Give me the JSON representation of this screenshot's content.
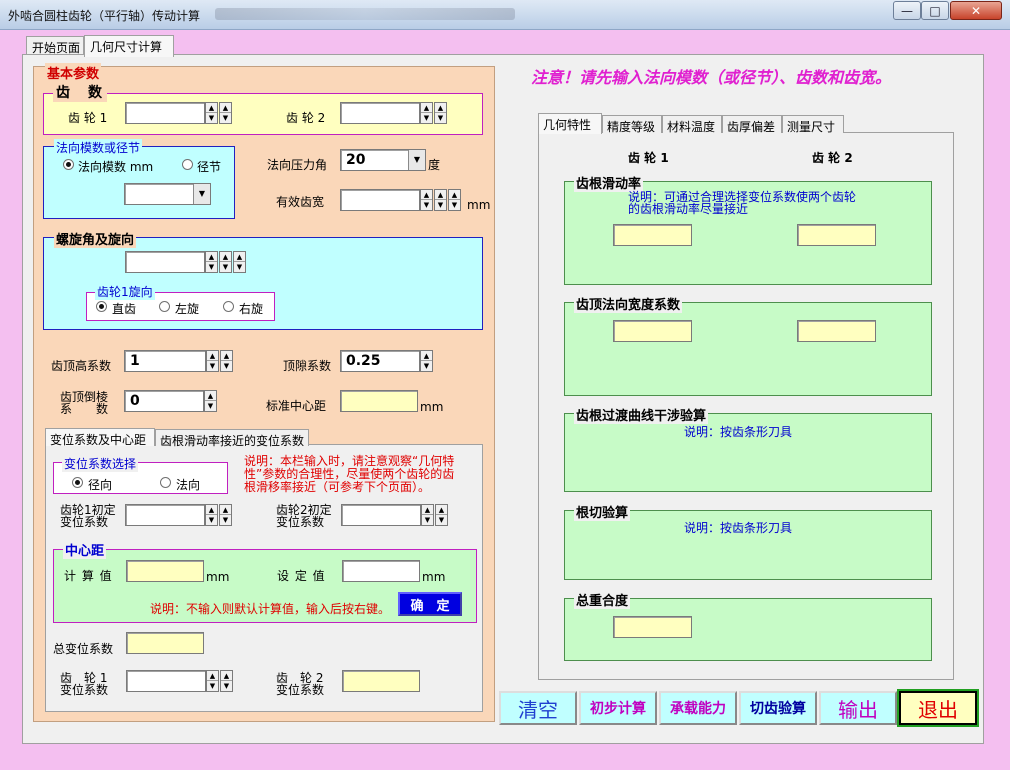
{
  "window": {
    "title": "外啮合圆柱齿轮（平行轴）传动计算",
    "min": "—",
    "max": "□",
    "close": "✕"
  },
  "tabs": [
    "开始页面",
    "几何尺寸计算"
  ],
  "basic": {
    "title": "基本参数",
    "teeth": {
      "title": "齿　数",
      "gear1": "齿 轮 1",
      "gear2": "齿 轮 2"
    },
    "module": {
      "title": "法向模数或径节",
      "opt1": "法向模数 mm",
      "opt2": "径节"
    },
    "pressure": {
      "label": "法向压力角",
      "value": "20",
      "unit": "度"
    },
    "facewidth": {
      "label": "有效齿宽",
      "unit": "mm"
    },
    "helix": {
      "title": "螺旋角及旋向",
      "sub": "齿轮1旋向",
      "opt1": "直齿",
      "opt2": "左旋",
      "opt3": "右旋"
    },
    "addendum": {
      "label": "齿顶高系数",
      "value": "1"
    },
    "clearance": {
      "label": "顶隙系数",
      "value": "0.25"
    },
    "chamfer": {
      "label1": "齿顶倒棱",
      "label2": "系　　数",
      "value": "0"
    },
    "center_std": {
      "label": "标准中心距",
      "unit": "mm"
    }
  },
  "subtabs": [
    "变位系数及中心距",
    "齿根滑动率接近的变位系数"
  ],
  "shift": {
    "title": "变位系数选择",
    "opt1": "径向",
    "opt2": "法向",
    "note": "说明：本栏输入时，请注意观察“几何特性”参数的合理性，尽量使两个齿轮的齿根滑移率接近（可参考下个页面）。",
    "g1a": "齿轮1初定",
    "g1b": "变位系数",
    "g2a": "齿轮2初定",
    "g2b": "变位系数"
  },
  "center": {
    "title": "中心距",
    "calc": "计 算 值",
    "calc_unit": "mm",
    "set": "设 定 值",
    "set_unit": "mm",
    "note": "说明：不输入则默认计算值，输入后按右键。",
    "ok": "确　定"
  },
  "total": {
    "label": "总变位系数"
  },
  "final": {
    "g1a": "齿　轮 1",
    "g1b": "变位系数",
    "g2a": "齿　轮 2",
    "g2b": "变位系数"
  },
  "notice": "注意！请先输入法向模数（或径节）、齿数和齿宽。",
  "rtabs": [
    "几何特性",
    "精度等级",
    "材料温度",
    "齿厚偏差",
    "测量尺寸"
  ],
  "geo": {
    "gear1": "齿 轮 1",
    "gear2": "齿 轮 2",
    "s1": {
      "title": "齿根滑动率",
      "note1": "说明：可通过合理选择变位系数使两个齿轮",
      "note2": "的齿根滑动率尽量接近"
    },
    "s2": {
      "title": "齿顶法向宽度系数"
    },
    "s3": {
      "title": "齿根过渡曲线干涉验算",
      "note": "说明：按齿条形刀具"
    },
    "s4": {
      "title": "根切验算",
      "note": "说明：按齿条形刀具"
    },
    "s5": {
      "title": "总重合度"
    }
  },
  "buttons": {
    "clear": "清空",
    "prelim": "初步计算",
    "capacity": "承载能力",
    "cut": "切齿验算",
    "output": "输出",
    "exit": "退出"
  },
  "colors": {
    "accent_red": "#e00000",
    "magenta": "#e020d0",
    "blue_text": "#0000d0",
    "green_panel": "#c7fbc7",
    "orange_panel": "#fad7b9",
    "cyan_panel": "#c0ffff"
  }
}
